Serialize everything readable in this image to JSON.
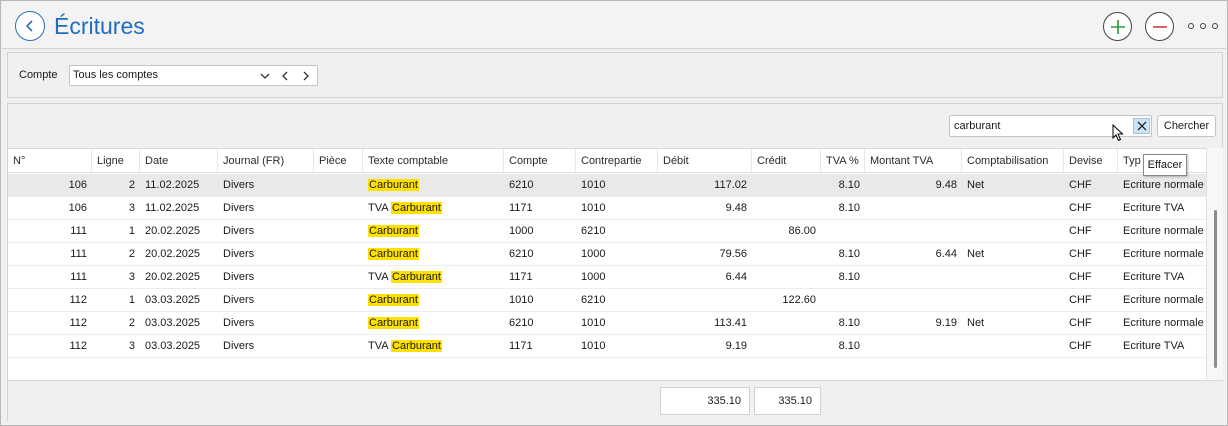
{
  "header": {
    "title": "Écritures",
    "back_icon": "chevron-left-icon",
    "add_icon": "plus-icon",
    "remove_icon": "minus-icon",
    "more_icon": "more-dots-icon",
    "colors": {
      "title": "#1f6cc2",
      "add": "#2e9a3c",
      "remove": "#d23c3c"
    }
  },
  "filter": {
    "label": "Compte",
    "account_value": "Tous les comptes"
  },
  "search": {
    "value": "carburant",
    "button_label": "Chercher",
    "clear_tooltip": "Effacer"
  },
  "table": {
    "columns": [
      "N°",
      "Ligne",
      "Date",
      "Journal (FR)",
      "Pièce",
      "Texte comptable",
      "Compte",
      "Contrepartie",
      "Débit",
      "Crédit",
      "TVA %",
      "Montant TVA",
      "Comptabilisation",
      "Devise",
      "Typ"
    ],
    "highlight_color": "#ffe100",
    "rows": [
      {
        "no": "106",
        "ligne": "2",
        "date": "11.02.2025",
        "journal": "Divers",
        "piece": "",
        "texte_pre": "",
        "texte_hl": "Carburant",
        "compte": "6210",
        "contre": "1010",
        "debit": "117.02",
        "credit": "",
        "tva": "8.10",
        "montant_tva": "9.48",
        "compta": "Net",
        "devise": "CHF",
        "type": "Ecriture normale"
      },
      {
        "no": "106",
        "ligne": "3",
        "date": "11.02.2025",
        "journal": "Divers",
        "piece": "",
        "texte_pre": "TVA ",
        "texte_hl": "Carburant",
        "compte": "1171",
        "contre": "1010",
        "debit": "9.48",
        "credit": "",
        "tva": "8.10",
        "montant_tva": "",
        "compta": "",
        "devise": "CHF",
        "type": "Ecriture TVA"
      },
      {
        "no": "111",
        "ligne": "1",
        "date": "20.02.2025",
        "journal": "Divers",
        "piece": "",
        "texte_pre": "",
        "texte_hl": "Carburant",
        "compte": "1000",
        "contre": "6210",
        "debit": "",
        "credit": "86.00",
        "tva": "",
        "montant_tva": "",
        "compta": "",
        "devise": "CHF",
        "type": "Ecriture normale"
      },
      {
        "no": "111",
        "ligne": "2",
        "date": "20.02.2025",
        "journal": "Divers",
        "piece": "",
        "texte_pre": "",
        "texte_hl": "Carburant",
        "compte": "6210",
        "contre": "1000",
        "debit": "79.56",
        "credit": "",
        "tva": "8.10",
        "montant_tva": "6.44",
        "compta": "Net",
        "devise": "CHF",
        "type": "Ecriture normale"
      },
      {
        "no": "111",
        "ligne": "3",
        "date": "20.02.2025",
        "journal": "Divers",
        "piece": "",
        "texte_pre": "TVA ",
        "texte_hl": "Carburant",
        "compte": "1171",
        "contre": "1000",
        "debit": "6.44",
        "credit": "",
        "tva": "8.10",
        "montant_tva": "",
        "compta": "",
        "devise": "CHF",
        "type": "Ecriture TVA"
      },
      {
        "no": "112",
        "ligne": "1",
        "date": "03.03.2025",
        "journal": "Divers",
        "piece": "",
        "texte_pre": "",
        "texte_hl": "Carburant",
        "compte": "1010",
        "contre": "6210",
        "debit": "",
        "credit": "122.60",
        "tva": "",
        "montant_tva": "",
        "compta": "",
        "devise": "CHF",
        "type": "Ecriture normale"
      },
      {
        "no": "112",
        "ligne": "2",
        "date": "03.03.2025",
        "journal": "Divers",
        "piece": "",
        "texte_pre": "",
        "texte_hl": "Carburant",
        "compte": "6210",
        "contre": "1010",
        "debit": "113.41",
        "credit": "",
        "tva": "8.10",
        "montant_tva": "9.19",
        "compta": "Net",
        "devise": "CHF",
        "type": "Ecriture normale"
      },
      {
        "no": "112",
        "ligne": "3",
        "date": "03.03.2025",
        "journal": "Divers",
        "piece": "",
        "texte_pre": "TVA ",
        "texte_hl": "Carburant",
        "compte": "1171",
        "contre": "1010",
        "debit": "9.19",
        "credit": "",
        "tva": "8.10",
        "montant_tva": "",
        "compta": "",
        "devise": "CHF",
        "type": "Ecriture TVA"
      }
    ],
    "selected_row": 0
  },
  "totals": {
    "debit": "335.10",
    "credit": "335.10"
  }
}
